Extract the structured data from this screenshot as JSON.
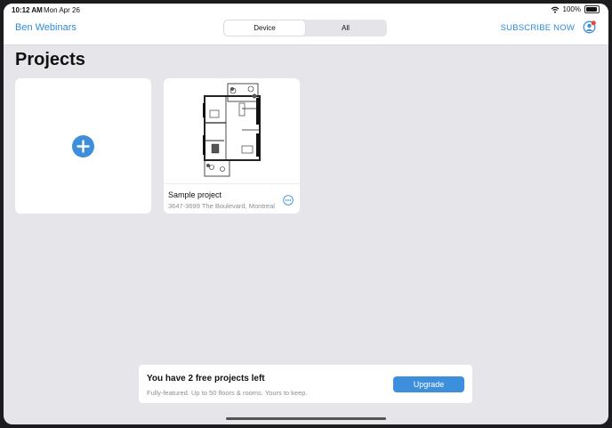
{
  "status": {
    "time": "10:12 AM",
    "date": "Mon Apr 26",
    "battery": "100%",
    "icons": [
      "wifi-icon",
      "battery-icon"
    ]
  },
  "header": {
    "title": "Ben Webinars",
    "segments": [
      {
        "label": "Device",
        "selected": true
      },
      {
        "label": "All",
        "selected": false
      }
    ],
    "subscribe_label": "SUBSCRIBE NOW",
    "profile_icon": "profile-icon",
    "profile_badge_color": "#e24a3b"
  },
  "main": {
    "title": "Projects",
    "new_project_icon": "plus-icon",
    "projects": [
      {
        "name": "Sample project",
        "address": "3647-3699 The Boulevard, Montreal",
        "menu_icon": "ellipsis-icon"
      }
    ]
  },
  "banner": {
    "title": "You have 2 free projects left",
    "subtitle": "Fully-featured. Up to 50 floors & rooms. Yours to keep.",
    "button_label": "Upgrade"
  },
  "colors": {
    "accent": "#3d8fdb",
    "link": "#2f8ad8",
    "background": "#e6e5ea"
  }
}
